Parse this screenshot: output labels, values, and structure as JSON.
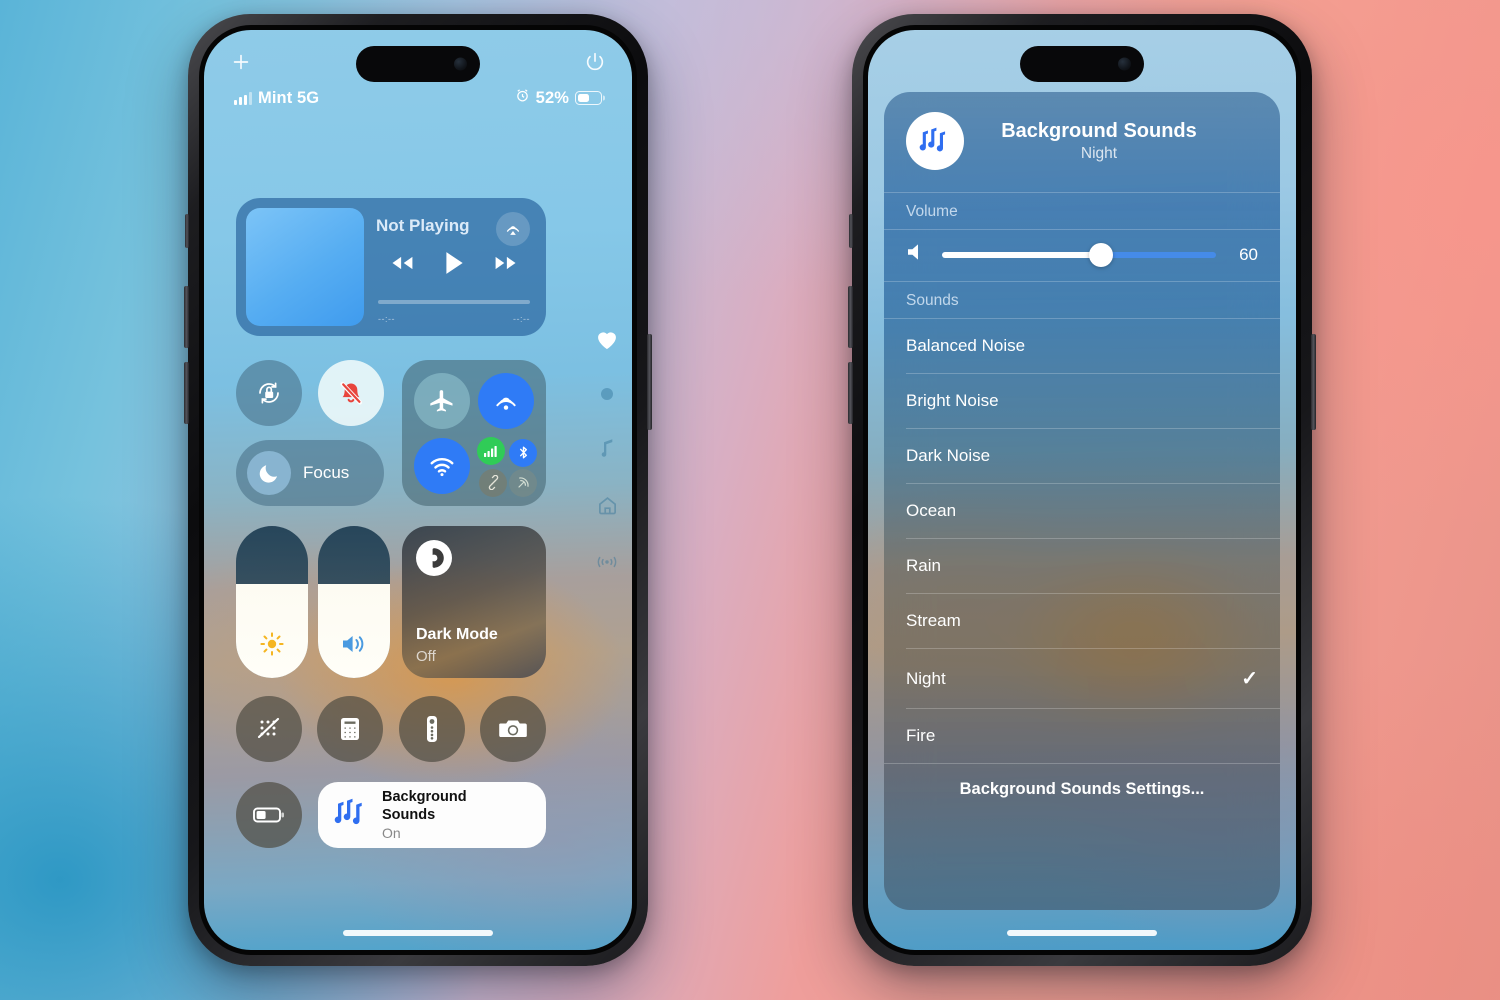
{
  "background": {
    "left_color": "#4aa0cc",
    "right_color": "#f09a8e"
  },
  "left_phone": {
    "name": "iPhone Control Center",
    "top_bar": {
      "add_icon": "plus-icon",
      "power_icon": "power-icon"
    },
    "status_bar": {
      "signal_icon": "cellular-signal-icon",
      "carrier": "Mint 5G",
      "alarm_icon": "alarm-clock-icon",
      "battery_percent": "52%",
      "battery_icon": "battery-icon"
    },
    "media": {
      "title": "Not Playing",
      "album_art": "album-art-placeholder",
      "airplay_icon": "airplay-icon",
      "rewind_icon": "rewind-icon",
      "play_icon": "play-icon",
      "forward_icon": "fast-forward-icon",
      "elapsed": "--:--",
      "remaining": "--:--"
    },
    "toggles": {
      "rotation_lock_icon": "rotation-lock-icon",
      "silent_mode_icon": "bell-slash-icon",
      "focus_label": "Focus",
      "focus_icon": "moon-icon"
    },
    "connectivity": {
      "airplane_icon": "airplane-mode-icon",
      "airdrop_icon": "airdrop-icon",
      "wifi_icon": "wifi-icon",
      "cellular_icon": "cellular-data-icon",
      "bluetooth_icon": "bluetooth-icon",
      "hotspot_icon": "personal-hotspot-icon",
      "satellite_icon": "satellite-icon"
    },
    "sliders": {
      "brightness_icon": "brightness-icon",
      "brightness_value": 62,
      "volume_icon": "speaker-icon",
      "volume_value": 62
    },
    "dark_mode": {
      "icon": "dark-mode-icon",
      "title": "Dark Mode",
      "state": "Off"
    },
    "shortcuts": [
      {
        "icon": "screen-mirroring-off-icon",
        "name": "screen-mirroring"
      },
      {
        "icon": "calculator-icon",
        "name": "calculator"
      },
      {
        "icon": "apple-tv-remote-icon",
        "name": "apple-tv-remote"
      },
      {
        "icon": "camera-icon",
        "name": "camera"
      }
    ],
    "low_power": {
      "icon": "low-power-mode-icon"
    },
    "background_sounds": {
      "icon": "music-notes-icon",
      "title_line1": "Background",
      "title_line2": "Sounds",
      "state": "On"
    },
    "rail": [
      {
        "icon": "heart-icon",
        "name": "favorites-page",
        "active": true
      },
      {
        "icon": "dot-icon",
        "name": "controls-page",
        "active": false
      },
      {
        "icon": "music-note-icon",
        "name": "media-page",
        "active": false
      },
      {
        "icon": "home-icon",
        "name": "home-page",
        "active": false
      },
      {
        "icon": "connectivity-icon",
        "name": "connectivity-page",
        "active": false
      }
    ]
  },
  "right_phone": {
    "name": "Background Sounds Panel",
    "header": {
      "icon": "music-notes-icon",
      "title": "Background Sounds",
      "subtitle": "Night"
    },
    "volume_section": {
      "label": "Volume",
      "speaker_icon": "speaker-icon",
      "value": "60",
      "percent": 58
    },
    "sounds_section": {
      "label": "Sounds",
      "items": [
        {
          "label": "Balanced Noise",
          "selected": false
        },
        {
          "label": "Bright Noise",
          "selected": false
        },
        {
          "label": "Dark Noise",
          "selected": false
        },
        {
          "label": "Ocean",
          "selected": false
        },
        {
          "label": "Rain",
          "selected": false
        },
        {
          "label": "Stream",
          "selected": false
        },
        {
          "label": "Night",
          "selected": true
        },
        {
          "label": "Fire",
          "selected": false
        }
      ],
      "checkmark": "✓"
    },
    "settings_link": "Background Sounds Settings..."
  }
}
